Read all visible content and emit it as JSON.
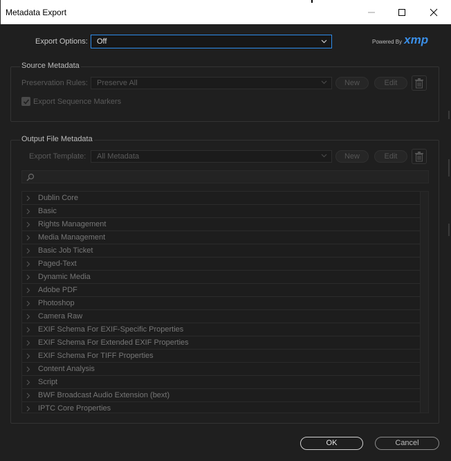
{
  "window": {
    "title": "Metadata Export"
  },
  "export_options": {
    "label": "Export Options:",
    "value": "Off"
  },
  "branding": {
    "powered_by": "Powered By",
    "logo": "xmp"
  },
  "source_metadata": {
    "title": "Source Metadata",
    "preservation_label": "Preservation Rules:",
    "preservation_value": "Preserve All",
    "new_label": "New",
    "edit_label": "Edit",
    "checkbox_label": "Export Sequence Markers",
    "checkbox_checked": true
  },
  "output_file_metadata": {
    "title": "Output File Metadata",
    "template_label": "Export Template:",
    "template_value": "All Metadata",
    "new_label": "New",
    "edit_label": "Edit",
    "search_placeholder": "",
    "schemas": [
      "Dublin Core",
      "Basic",
      "Rights Management",
      "Media Management",
      "Basic Job Ticket",
      "Paged-Text",
      "Dynamic Media",
      "Adobe PDF",
      "Photoshop",
      "Camera Raw",
      "EXIF Schema For EXIF-Specific Properties",
      "EXIF Schema For Extended EXIF Properties",
      "EXIF Schema For TIFF Properties",
      "Content Analysis",
      "Script",
      "BWF Broadcast Audio Extension (bext)",
      "IPTC Core Properties"
    ]
  },
  "footer": {
    "ok_label": "OK",
    "cancel_label": "Cancel"
  },
  "colors": {
    "accent": "#2d8ceb",
    "xmp_blue": "#3a8ee6",
    "background": "#1f1f1f"
  }
}
